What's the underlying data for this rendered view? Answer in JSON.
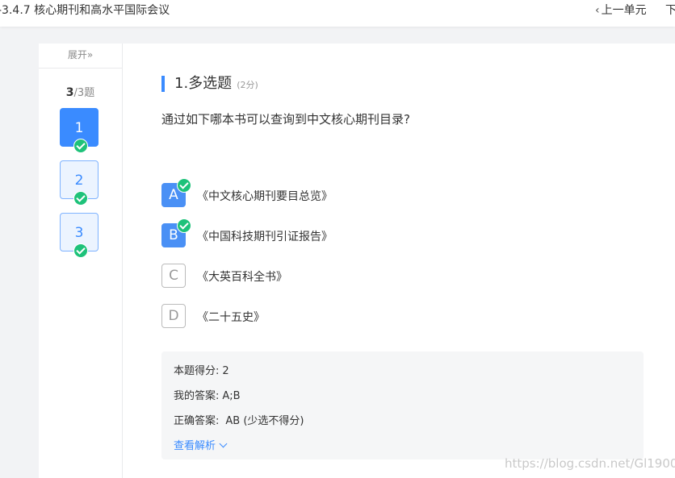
{
  "header": {
    "title": "-3.4.7 核心期刊和高水平国际会议",
    "prev_label": "上一单元",
    "next_label": "下"
  },
  "sidebar": {
    "expand_label": "展开»",
    "current": "3",
    "total": "/3题",
    "questions": [
      {
        "label": "1",
        "state": "active"
      },
      {
        "label": "2",
        "state": "answered"
      },
      {
        "label": "3",
        "state": "answered"
      }
    ]
  },
  "question": {
    "title": "1.多选题",
    "score": "(2分)",
    "stem": "通过如下哪本书可以查询到中文核心期刊目录?",
    "options": [
      {
        "letter": "A",
        "text": "《中文核心期刊要目总览》",
        "selected": true
      },
      {
        "letter": "B",
        "text": "《中国科技期刊引证报告》",
        "selected": true
      },
      {
        "letter": "C",
        "text": "《大英百科全书》",
        "selected": false
      },
      {
        "letter": "D",
        "text": "《二十五史》",
        "selected": false
      }
    ]
  },
  "result": {
    "score_label": "本题得分:",
    "score_value": "2",
    "my_answer_label": "我的答案:",
    "my_answer_value": "A;B",
    "correct_label": "正确答案:",
    "correct_value": "AB (少选不得分)",
    "analysis_label": "查看解析"
  },
  "watermark": "https://blog.csdn.net/Gl1900",
  "colors": {
    "accent": "#3a8bff",
    "check": "#1ec27a",
    "panel_bg": "#f5f6f7",
    "page_bg": "#f2f3f5"
  }
}
